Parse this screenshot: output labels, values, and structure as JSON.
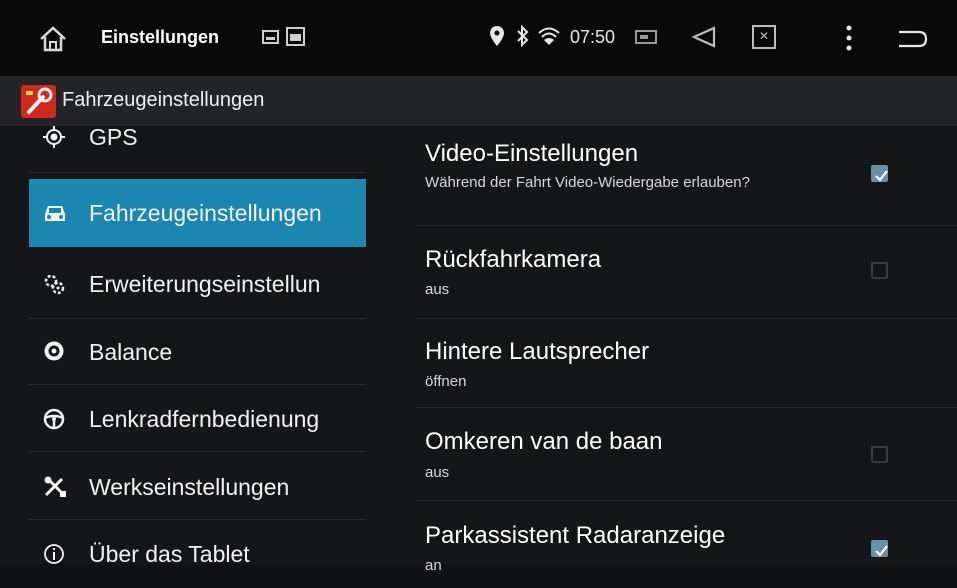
{
  "statusbar": {
    "title": "Einstellungen",
    "time": "07:50"
  },
  "appbar": {
    "title": "Fahrzeugeinstellungen",
    "icon_color": "#d1281c"
  },
  "sidebar": {
    "selected_color": "#1b86b0",
    "items": [
      {
        "label": "GPS",
        "icon": "gps-icon"
      },
      {
        "label": "Fahrzeugeinstellungen",
        "icon": "car-icon",
        "selected": true
      },
      {
        "label": "Erweiterungseinstellun",
        "icon": "gears-icon"
      },
      {
        "label": "Balance",
        "icon": "speaker-icon"
      },
      {
        "label": "Lenkradfernbedienung",
        "icon": "steering-wheel-icon"
      },
      {
        "label": "Werkseinstellungen",
        "icon": "tools-icon"
      },
      {
        "label": "Über das Tablet",
        "icon": "info-icon"
      }
    ]
  },
  "settings": {
    "accent": "#6a8fa8",
    "items": [
      {
        "title": "Video-Einstellungen",
        "subtitle": "Während der Fahrt Video-Wiedergabe erlauben?",
        "checkbox": true,
        "checked": true
      },
      {
        "title": "Rückfahrkamera",
        "subtitle": "aus",
        "checkbox": true,
        "checked": false
      },
      {
        "title": "Hintere Lautsprecher",
        "subtitle": "öffnen",
        "checkbox": false
      },
      {
        "title": "Omkeren van de baan",
        "subtitle": "aus",
        "checkbox": true,
        "checked": false
      },
      {
        "title": "Parkassistent Radaranzeige",
        "subtitle": "an",
        "checkbox": true,
        "checked": true
      }
    ]
  }
}
